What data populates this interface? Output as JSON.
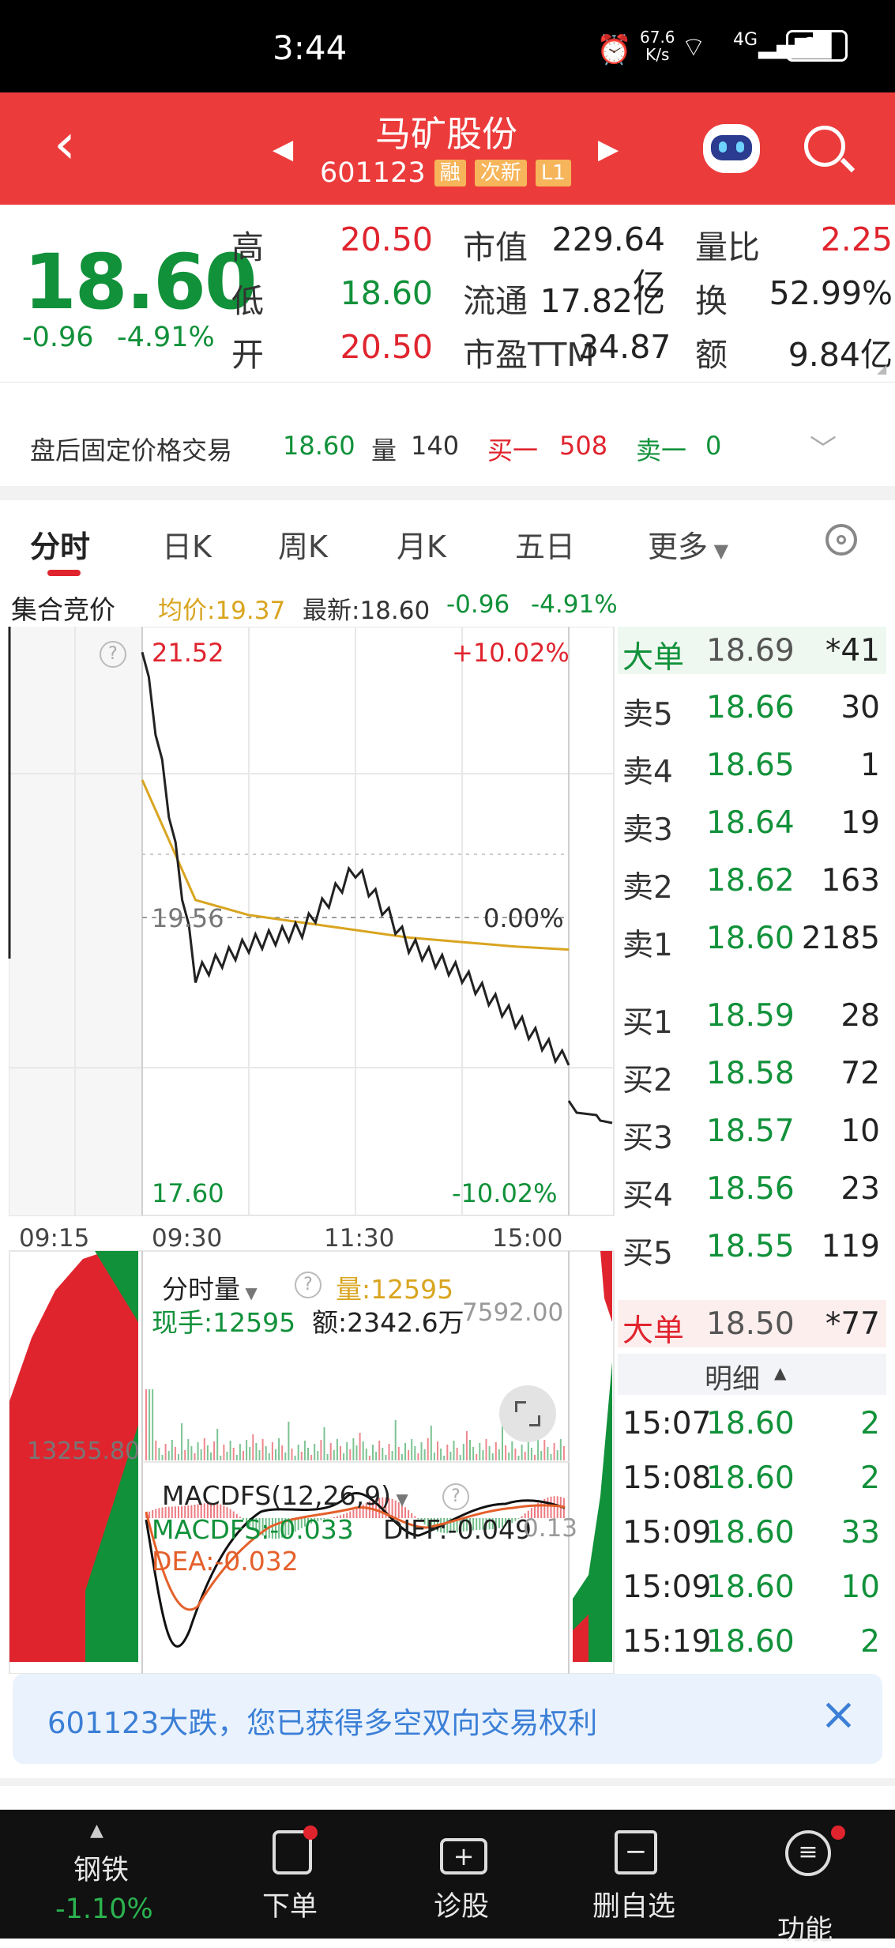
{
  "status_bar": {
    "time": "3:44",
    "net_speed_top": "67.6",
    "net_speed_unit": "K/s",
    "network": "4G",
    "battery": "81"
  },
  "header": {
    "stock_name": "马矿股份",
    "stock_code": "601123",
    "tags": [
      "融",
      "次新",
      "L1"
    ]
  },
  "quote": {
    "price": "18.60",
    "change": "-0.96",
    "change_pct": "-4.91%",
    "rows": [
      {
        "l1": "高",
        "v1": "20.50",
        "l2": "市值",
        "v2": "229.64亿",
        "l3": "量比",
        "v3": "2.25"
      },
      {
        "l1": "低",
        "v1": "18.60",
        "l2": "流通",
        "v2": "17.82亿",
        "l3": "换",
        "v3": "52.99%"
      },
      {
        "l1": "开",
        "v1": "20.50",
        "l2": "市盈TTM",
        "v2": "34.87",
        "l3": "额",
        "v3": "9.84亿"
      }
    ]
  },
  "after_hours": {
    "label": "盘后固定价格交易",
    "price": "18.60",
    "vol_label": "量",
    "vol": "140",
    "buy1_label": "买一",
    "buy1": "508",
    "sell1_label": "卖一",
    "sell1": "0"
  },
  "tabs": [
    "分时",
    "日K",
    "周K",
    "月K",
    "五日",
    "更多"
  ],
  "chart_header": {
    "auction": "集合竞价",
    "avg_label": "均价:19.37",
    "latest_label": "最新:18.60",
    "chg": "-0.96",
    "chg_pct": "-4.91%"
  },
  "chart": {
    "y_high": "21.52",
    "y_high_pct": "+10.02%",
    "y_mid": "19.56",
    "y_mid_pct": "0.00%",
    "y_low": "17.60",
    "y_low_pct": "-10.02%",
    "times": [
      "09:15",
      "09:30",
      "11:30",
      "15:00"
    ],
    "vol_title": "分时量",
    "vol_total": "量:12595",
    "vol_now": "现手:12595",
    "amount": "额:2342.6万",
    "vol_max": "7592.00",
    "auction_vol": "13255.80",
    "macd_title": "MACDFS(12,26,9)",
    "macd_val": "MACDFS:-0.033",
    "diff_val": "DIFF:-0.049",
    "dea_val": "DEA:-0.032",
    "macd_right": "0.13",
    "help": "?"
  },
  "chart_data": {
    "type": "line",
    "title": "分时",
    "x": [
      "09:30",
      "10:00",
      "10:30",
      "11:00",
      "11:30",
      "13:30",
      "14:00",
      "14:30",
      "15:00"
    ],
    "series": [
      {
        "name": "最新",
        "values": [
          21.4,
          19.2,
          19.4,
          19.5,
          19.9,
          19.4,
          19.2,
          18.9,
          18.6
        ]
      },
      {
        "name": "均价",
        "values": [
          20.5,
          19.7,
          19.6,
          19.55,
          19.5,
          19.45,
          19.42,
          19.39,
          19.37
        ]
      }
    ],
    "ylim": [
      17.6,
      21.52
    ]
  },
  "book": {
    "big_top": {
      "label": "大单",
      "price": "18.69",
      "vol": "*41"
    },
    "asks": [
      {
        "label": "卖5",
        "price": "18.66",
        "vol": "30"
      },
      {
        "label": "卖4",
        "price": "18.65",
        "vol": "1"
      },
      {
        "label": "卖3",
        "price": "18.64",
        "vol": "19"
      },
      {
        "label": "卖2",
        "price": "18.62",
        "vol": "163"
      },
      {
        "label": "卖1",
        "price": "18.60",
        "vol": "2185"
      }
    ],
    "bids": [
      {
        "label": "买1",
        "price": "18.59",
        "vol": "28"
      },
      {
        "label": "买2",
        "price": "18.58",
        "vol": "72"
      },
      {
        "label": "买3",
        "price": "18.57",
        "vol": "10"
      },
      {
        "label": "买4",
        "price": "18.56",
        "vol": "23"
      },
      {
        "label": "买5",
        "price": "18.55",
        "vol": "119"
      }
    ],
    "big_bottom": {
      "label": "大单",
      "price": "18.50",
      "vol": "*77"
    },
    "detail_title": "明细",
    "ticks": [
      {
        "time": "15:07",
        "price": "18.60",
        "vol": "2"
      },
      {
        "time": "15:08",
        "price": "18.60",
        "vol": "2"
      },
      {
        "time": "15:09",
        "price": "18.60",
        "vol": "33"
      },
      {
        "time": "15:09",
        "price": "18.60",
        "vol": "10"
      },
      {
        "time": "15:19",
        "price": "18.60",
        "vol": "2"
      }
    ]
  },
  "notice": {
    "text": "601123大跌，您已获得多空双向交易权利"
  },
  "bottom_nav": {
    "sector": "钢铁",
    "sector_chg": "-1.10%",
    "items": [
      "下单",
      "诊股",
      "删自选",
      "功能"
    ]
  },
  "colors": {
    "header_red": "#ec3b3b",
    "up_red": "#e0242e",
    "down_green": "#11913a",
    "avg_line": "#d9a520"
  }
}
